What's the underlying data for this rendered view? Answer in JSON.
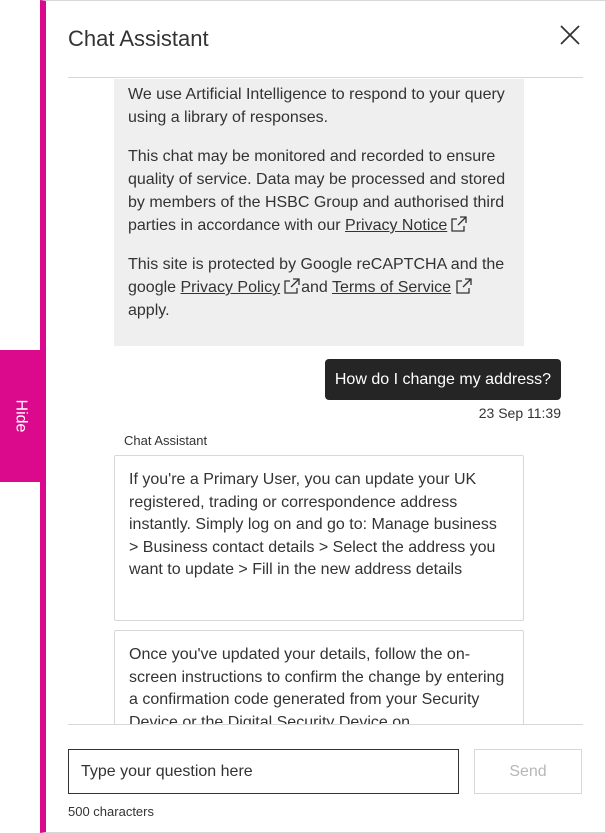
{
  "hide_tab": {
    "label": "Hide"
  },
  "header": {
    "title": "Chat Assistant"
  },
  "disclaimer": {
    "para1": "We use Artificial Intelligence to respond to your query using a library of responses.",
    "para2": "This chat may be monitored and recorded to ensure quality of service. Data may be processed and stored by members of the HSBC Group and authorised third parties in accordance with our",
    "privacy_notice_link": "Privacy Notice",
    "para3_start": "This site is protected by Google reCAPTCHA and the google",
    "privacy_policy_link": "Privacy Policy",
    "para3_and": "and",
    "terms_link": "Terms of Service",
    "para3_end": "apply."
  },
  "messages": {
    "user_message": "How do I change my address?",
    "user_timestamp": "23 Sep 11:39",
    "agent_name": "Chat Assistant",
    "bot_message_1": "If you're a Primary User, you can update your UK registered, trading or correspondence address instantly. Simply log on and go to: Manage business > Business contact details > Select the address you want to update > Fill in the new address details",
    "bot_message_2": "Once you've updated your details, follow the on-screen instructions to confirm the change by entering a confirmation code generated from your Security Device or the Digital Security Device on"
  },
  "footer": {
    "input_placeholder": "Type your question here",
    "send_label": "Send",
    "char_count": "500 characters"
  },
  "colors": {
    "brand_pink": "#db0a8c",
    "user_bubble": "#252525",
    "disclaimer_bg": "#efefef",
    "border": "#d7d8d6",
    "disabled_text": "#b6b7b6"
  },
  "icons": [
    "close-icon",
    "external-link-icon"
  ]
}
